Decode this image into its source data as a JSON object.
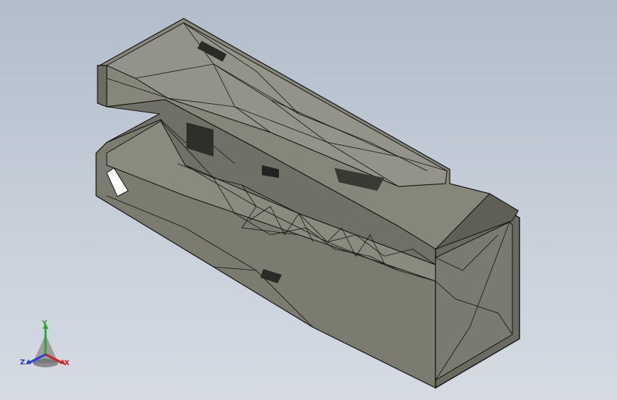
{
  "viewport": {
    "background_top": "#b2bdcb",
    "background_bottom": "#d6dbe3"
  },
  "model": {
    "name": "3d-part-mesh",
    "face_color": "#7a7a6e",
    "face_light": "#9a9a8c",
    "face_dark": "#5b5b52",
    "edge_color": "#000000"
  },
  "triad": {
    "x_label": "X",
    "y_label": "Y",
    "z_label": "Z",
    "x_color": "#d42020",
    "y_color": "#27a82a",
    "z_color": "#2a3fd4"
  }
}
